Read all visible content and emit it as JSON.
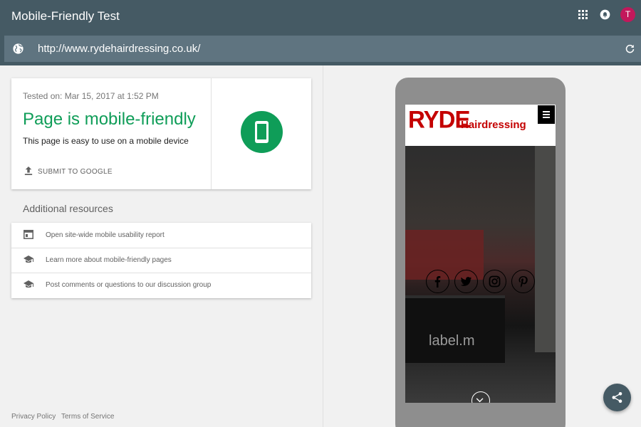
{
  "app": {
    "title": "Mobile-Friendly Test",
    "avatar_initial": "T",
    "icons": [
      "apps-icon",
      "notifications-icon",
      "avatar"
    ]
  },
  "urlbar": {
    "url": "http://www.rydehairdressing.co.uk/",
    "icons": [
      "globe-icon",
      "refresh-icon"
    ]
  },
  "result": {
    "tested_on": "Tested on: Mar 15, 2017 at 1:52 PM",
    "headline": "Page is mobile-friendly",
    "description": "This page is easy to use on a mobile device",
    "submit_label": "SUBMIT TO GOOGLE",
    "status_color": "#0f9d58"
  },
  "resources": {
    "title": "Additional resources",
    "items": [
      {
        "label": "Open site-wide mobile usability report",
        "icon": "report-icon"
      },
      {
        "label": "Learn more about mobile-friendly pages",
        "icon": "school-icon"
      },
      {
        "label": "Post comments or questions to our discussion group",
        "icon": "school-icon"
      }
    ]
  },
  "footer": {
    "privacy": "Privacy Policy",
    "terms": "Terms of Service"
  },
  "preview": {
    "brand_main": "RYDE",
    "brand_sub": "Hairdressing",
    "hero_text": "label.m",
    "social_icons": [
      "facebook-icon",
      "twitter-icon",
      "instagram-icon",
      "pinterest-icon"
    ],
    "brand_color": "#c40000"
  },
  "colors": {
    "appbar": "#455a64",
    "urlbar": "#5f7480",
    "avatar": "#c2185b"
  }
}
